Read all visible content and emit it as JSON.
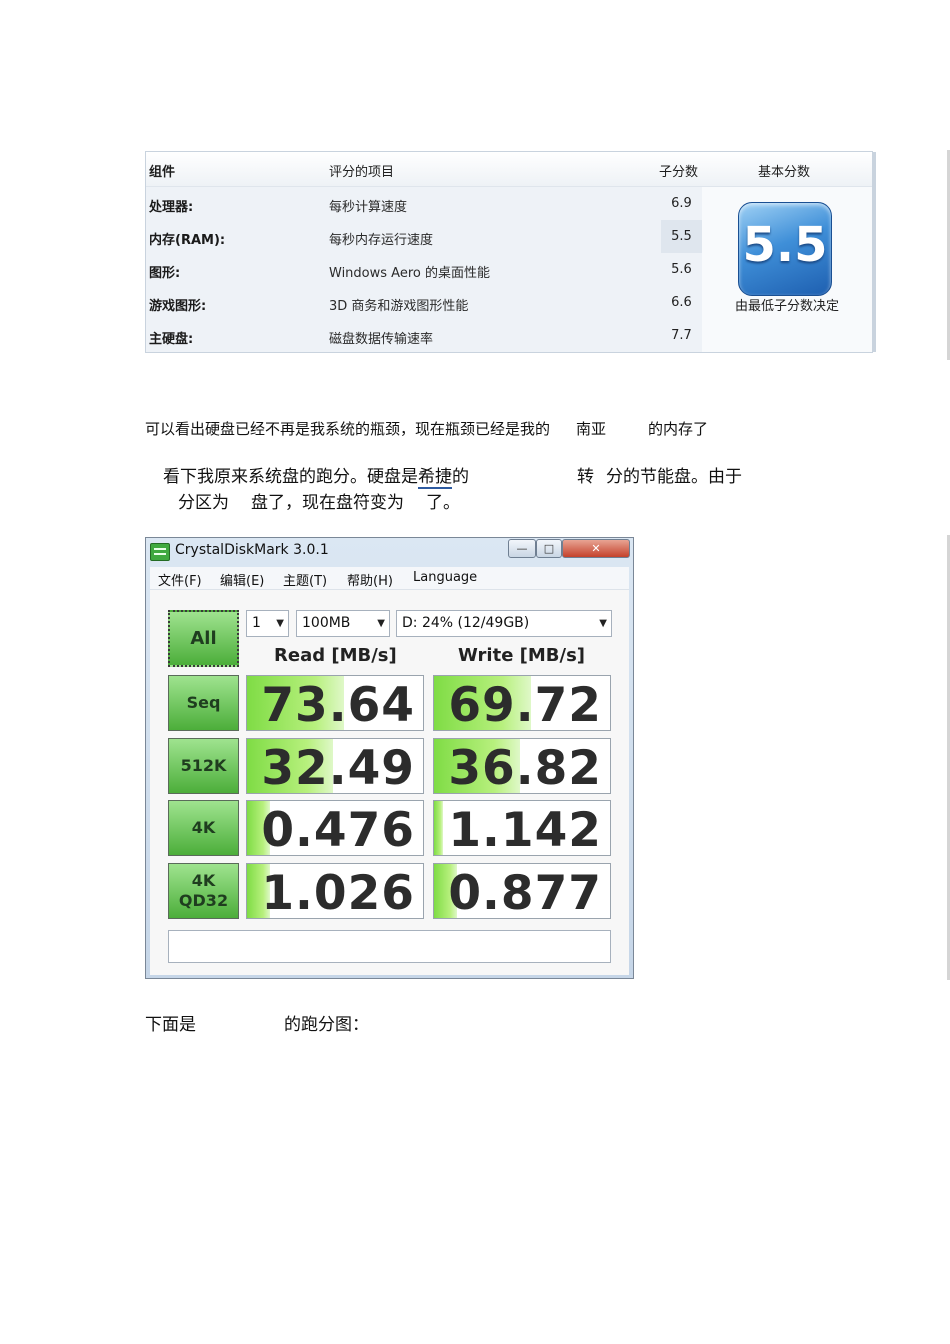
{
  "wei_table": {
    "headers": {
      "component": "组件",
      "rated_item": "评分的项目",
      "subscore": "子分数",
      "base_score": "基本分数"
    },
    "rows": [
      {
        "component": "处理器:",
        "item": "每秒计算速度",
        "subscore": "6.9"
      },
      {
        "component": "内存(RAM):",
        "item": "每秒内存运行速度",
        "subscore": "5.5"
      },
      {
        "component": "图形:",
        "item": "Windows Aero 的桌面性能",
        "subscore": "5.6"
      },
      {
        "component": "游戏图形:",
        "item": "3D 商务和游戏图形性能",
        "subscore": "6.6"
      },
      {
        "component": "主硬盘:",
        "item": "磁盘数据传输速率",
        "subscore": "7.7"
      }
    ],
    "base_score": "5.5",
    "base_score_caption": "由最低子分数决定"
  },
  "paragraphs": {
    "p1_a": "可以看出硬盘已经不再是我系统的瓶颈，现在瓶颈已经是我的",
    "p1_b": "南亚",
    "p1_c": "的内存了",
    "p2_a": "看下我原来系统盘的跑分。硬盘是",
    "p2_u": "希捷",
    "p2_b": "的",
    "p2_c": "转",
    "p2_d": "分的节能盘。由于",
    "p3_a": "分区为",
    "p3_b": "盘了，现在盘符变为",
    "p3_c": "了。",
    "p4_a": "下面是",
    "p4_b": "的跑分图："
  },
  "cdm": {
    "title": "CrystalDiskMark 3.0.1",
    "menu": [
      "文件(F)",
      "编辑(E)",
      "主题(T)",
      "帮助(H)",
      "Language"
    ],
    "all_button": "All",
    "count": "1",
    "size": "100MB",
    "drive": "D: 24% (12/49GB)",
    "read_header": "Read [MB/s]",
    "write_header": "Write [MB/s]",
    "tests": [
      {
        "label": [
          "Seq"
        ],
        "read": "73.64",
        "write": "69.72",
        "read_level": 0.55,
        "write_level": 0.55
      },
      {
        "label": [
          "512K"
        ],
        "read": "32.49",
        "write": "36.82",
        "read_level": 0.49,
        "write_level": 0.49
      },
      {
        "label": [
          "4K"
        ],
        "read": "0.476",
        "write": "1.142",
        "read_level": 0.13,
        "write_level": 0.05
      },
      {
        "label": [
          "4K",
          "QD32"
        ],
        "read": "1.026",
        "write": "0.877",
        "read_level": 0.13,
        "write_level": 0.13
      }
    ]
  }
}
